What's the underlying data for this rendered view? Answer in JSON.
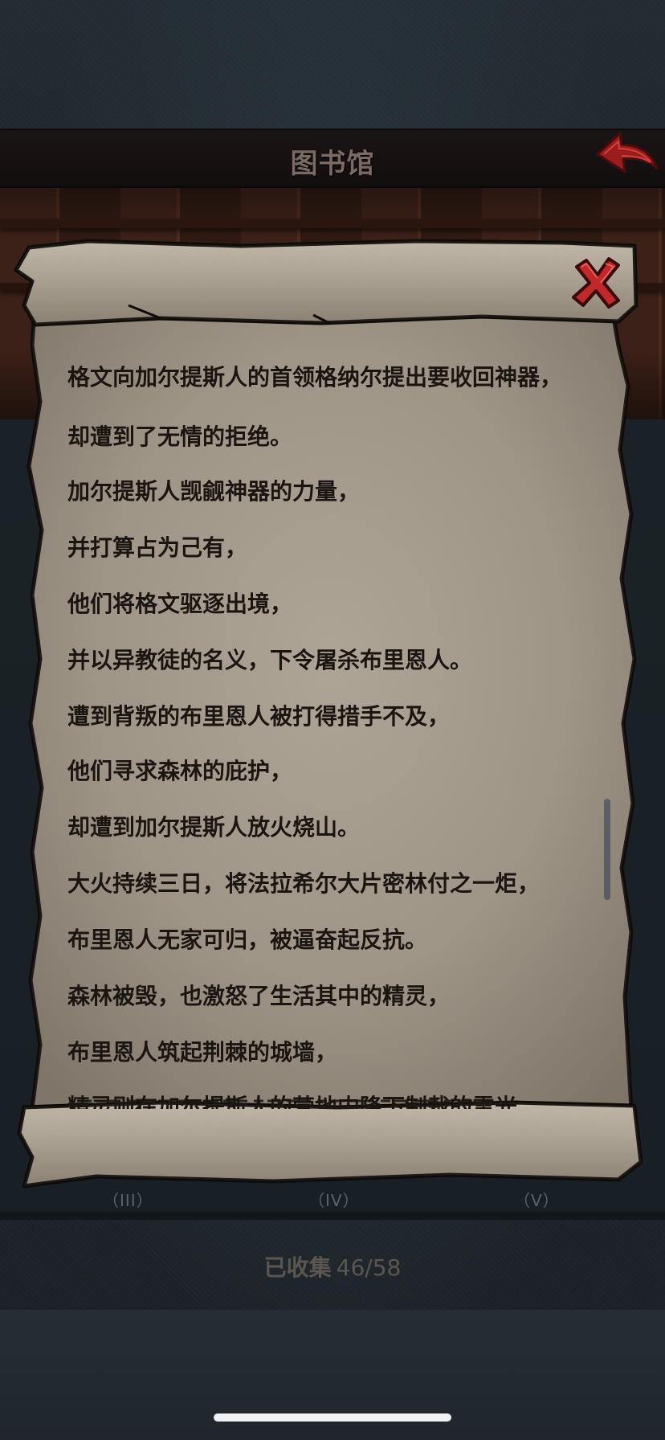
{
  "header": {
    "title": "图书馆",
    "back_icon": "back-arrow-icon"
  },
  "scroll": {
    "close_icon": "close-x-icon",
    "lines": [
      "格文向加尔提斯人的首领格纳尔提出要收回神器，",
      "却遭到了无情的拒绝。",
      "加尔提斯人觊觎神器的力量，",
      "并打算占为己有，",
      "他们将格文驱逐出境，",
      "并以异教徒的名义，下令屠杀布里恩人。",
      "遭到背叛的布里恩人被打得措手不及，",
      "他们寻求森林的庇护，",
      "却遭到加尔提斯人放火烧山。",
      "大火持续三日，将法拉希尔大片密林付之一炬，",
      "布里恩人无家可归，被逼奋起反抗。",
      "森林被毁，也激怒了生活其中的精灵，",
      "布里恩人筑起荆棘的城墙，",
      "精灵则在加尔提斯人的营地内降下制裁的雷光。"
    ]
  },
  "books": {
    "captions": [
      "（III）",
      "（IV）",
      "（V）"
    ]
  },
  "collected": {
    "label": "已收集",
    "count": "46/58"
  },
  "colors": {
    "paper": "#a69c8d",
    "text": "#1b1511",
    "close_red": "#c0282a"
  }
}
